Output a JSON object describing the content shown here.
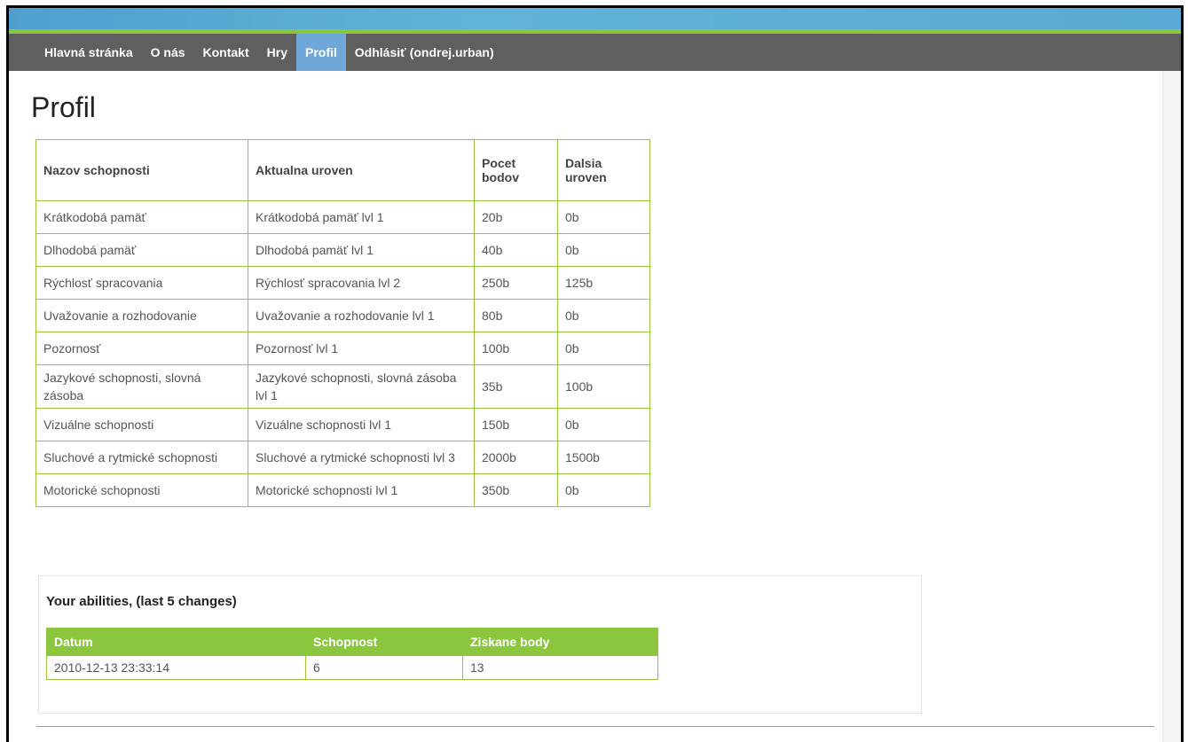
{
  "nav": {
    "items": [
      "Hlavná stránka",
      "O nás",
      "Kontakt",
      "Hry",
      "Profil",
      "Odhlásiť (ondrej.urban)"
    ],
    "active": "Profil"
  },
  "page": {
    "title": "Profil"
  },
  "skills_table": {
    "headers": [
      "Nazov schopnosti",
      "Aktualna uroven",
      "Pocet bodov",
      "Dalsia uroven"
    ],
    "rows": [
      [
        "Krátkodobá pamäť",
        "Krátkodobá pamäť lvl 1",
        "20b",
        "0b"
      ],
      [
        "Dlhodobá pamäť",
        "Dlhodobá pamäť lvl 1",
        "40b",
        "0b"
      ],
      [
        "Rýchlosť spracovania",
        "Rýchlosť spracovania lvl 2",
        "250b",
        "125b"
      ],
      [
        "Uvažovanie a rozhodovanie",
        "Uvažovanie a rozhodovanie lvl 1",
        "80b",
        "0b"
      ],
      [
        "Pozornosť",
        "Pozornosť lvl 1",
        "100b",
        "0b"
      ],
      [
        "Jazykové schopnosti, slovná zásoba",
        "Jazykové schopnosti, slovná zásoba lvl 1",
        "35b",
        "100b"
      ],
      [
        "Vizuálne schopnosti",
        "Vizuálne schopnosti lvl 1",
        "150b",
        "0b"
      ],
      [
        "Sluchové a rytmické schopnosti",
        "Sluchové a rytmické schopnosti lvl 3",
        "2000b",
        "1500b"
      ],
      [
        "Motorické schopnosti",
        "Motorické schopnosti lvl 1",
        "350b",
        "0b"
      ]
    ]
  },
  "abilities": {
    "title": "Your abilities, (last 5 changes)",
    "headers": [
      "Datum",
      "Schopnost",
      "Ziskane body"
    ],
    "rows": [
      [
        "2010-12-13 23:33:14",
        "6",
        "13"
      ]
    ]
  },
  "colors": {
    "nav_bg": "#5f5f5f",
    "nav_active": "#6fa7d9",
    "accent_green": "#8cc63f",
    "topbar_blue": "#5aa9d6"
  }
}
